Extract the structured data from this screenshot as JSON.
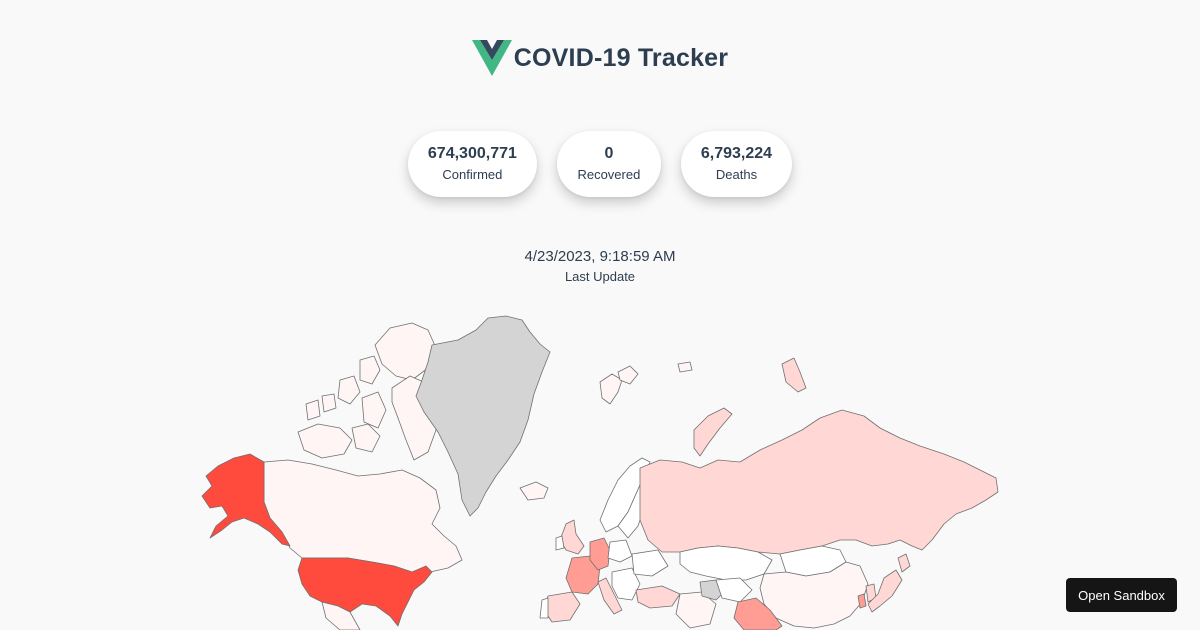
{
  "header": {
    "title": "COVID-19 Tracker",
    "logo_icon": "vue-logo-icon"
  },
  "stats": [
    {
      "value": "674,300,771",
      "label": "Confirmed"
    },
    {
      "value": "0",
      "label": "Recovered"
    },
    {
      "value": "6,793,224",
      "label": "Deaths"
    }
  ],
  "last_update": {
    "time": "4/23/2023, 9:18:59 AM",
    "label": "Last Update"
  },
  "sandbox": {
    "button_label": "Open Sandbox"
  },
  "colors": {
    "background": "#f9f9f9",
    "text": "#2c3e50",
    "logo_green": "#41b883",
    "logo_dark": "#35495e",
    "map_highest": "#ff4b3e",
    "map_high": "#ff9d95",
    "map_medium": "#ffd7d4",
    "map_low": "#fff5f5",
    "map_none": "#ffffff",
    "map_no_data": "#d4d4d4",
    "button_bg": "#151515"
  }
}
